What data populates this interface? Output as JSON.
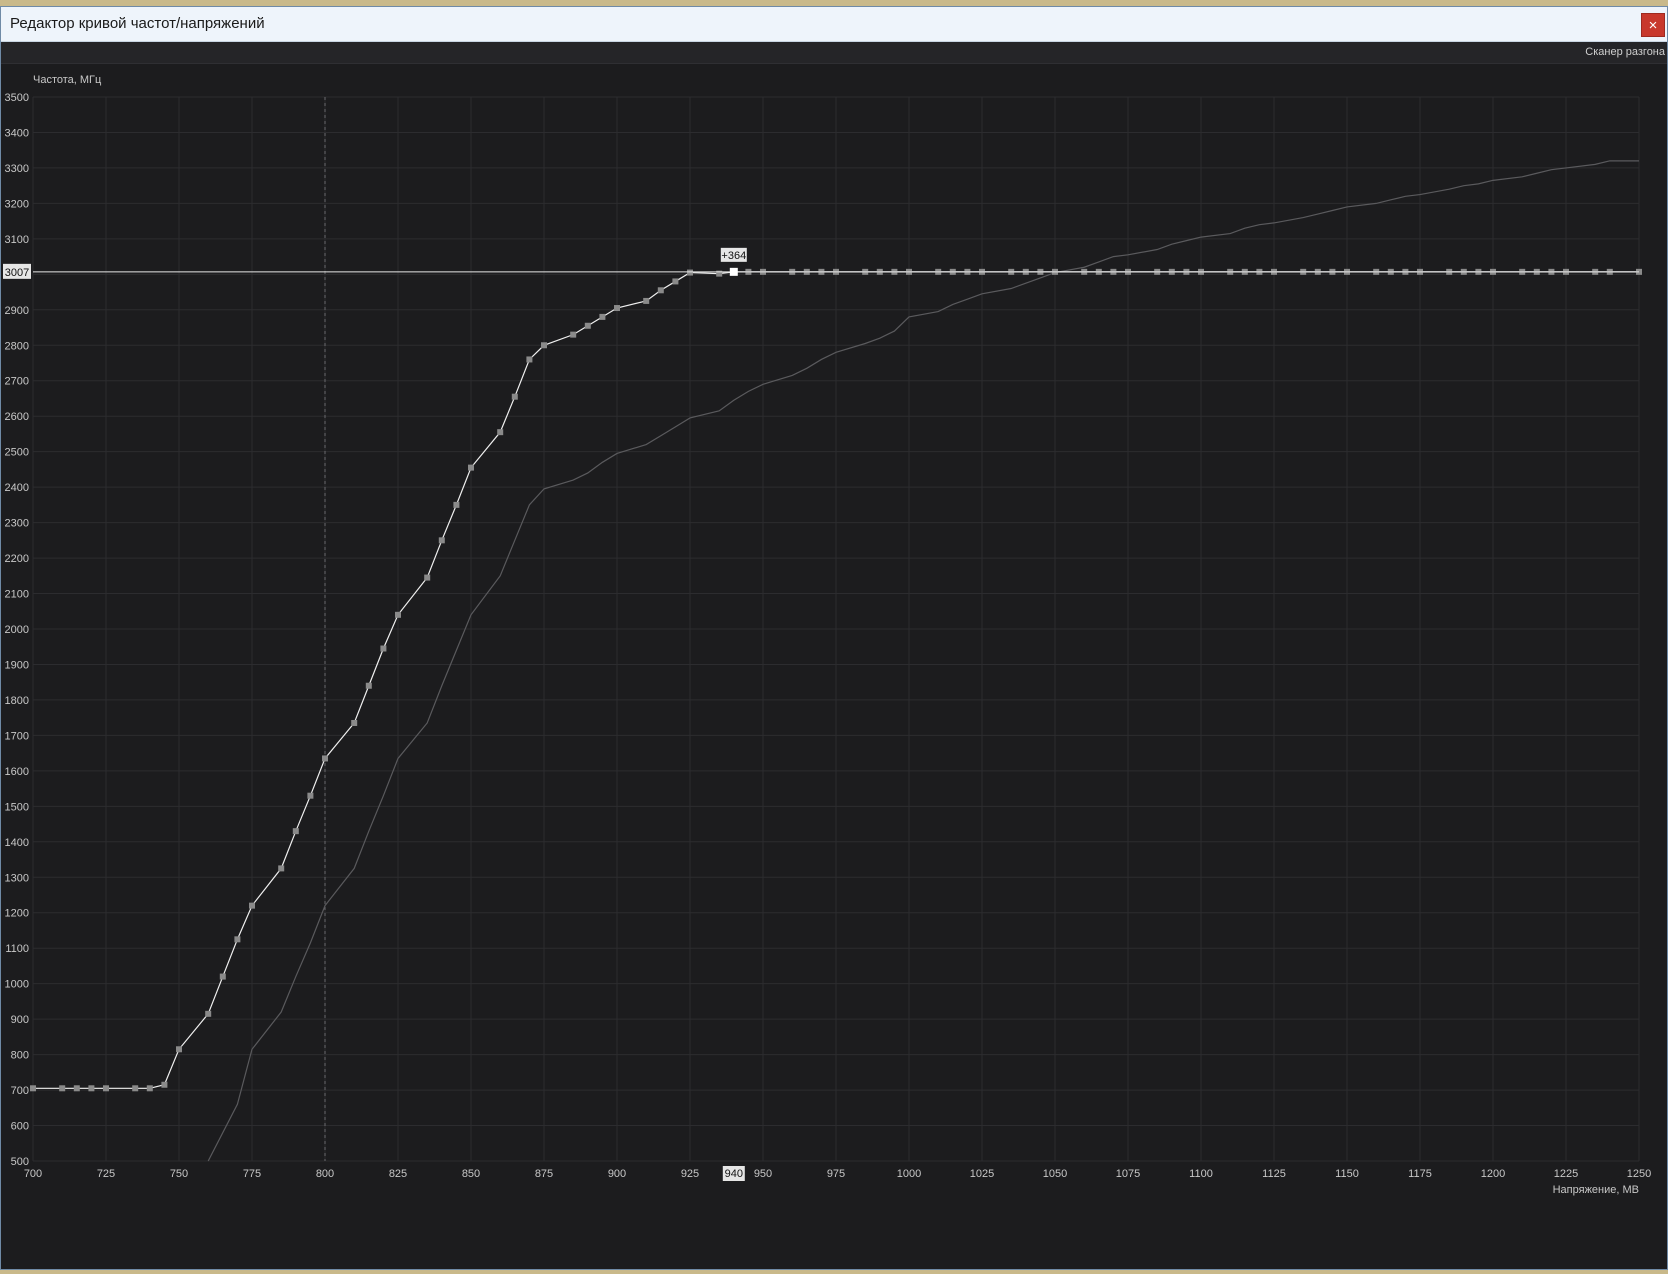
{
  "window": {
    "title": "Редактор кривой частот/напряжений",
    "close_glyph": "×"
  },
  "toolbar": {
    "scanner_label": "Сканер разгона"
  },
  "colors": {
    "background": "#1c1c1e",
    "grid": "#2c2c2f",
    "curve": "#f0f0f0",
    "reference_curve": "#5a5a5d",
    "point": "#8a8a8a",
    "axis_text": "#c8c8c8",
    "close": "#c8382c"
  },
  "chart_data": {
    "type": "line",
    "ylabel": "Частота, МГц",
    "xlabel": "Напряжение, МВ",
    "xlim": [
      700,
      1250
    ],
    "ylim": [
      500,
      3500
    ],
    "x_ticks": [
      700,
      725,
      750,
      775,
      800,
      825,
      850,
      875,
      900,
      925,
      950,
      975,
      1000,
      1025,
      1050,
      1075,
      1100,
      1125,
      1150,
      1175,
      1200,
      1225,
      1250
    ],
    "y_ticks": [
      500,
      600,
      700,
      800,
      900,
      1000,
      1100,
      1200,
      1300,
      1400,
      1500,
      1600,
      1700,
      1800,
      1900,
      2000,
      2100,
      2200,
      2300,
      2400,
      2500,
      2600,
      2700,
      2800,
      2900,
      3000,
      3100,
      3200,
      3300,
      3400,
      3500
    ],
    "grid": true,
    "vertical_marker_x": 800,
    "cursor": {
      "x": 940,
      "y": 3007,
      "x_label": "940",
      "y_label": "3007",
      "offset_label": "+364"
    },
    "series": [
      {
        "points": [
          [
            700,
            705
          ],
          [
            710,
            705
          ],
          [
            715,
            705
          ],
          [
            720,
            705
          ],
          [
            725,
            705
          ],
          [
            735,
            705
          ],
          [
            740,
            705
          ],
          [
            745,
            715
          ],
          [
            750,
            815
          ],
          [
            760,
            915
          ],
          [
            765,
            1020
          ],
          [
            770,
            1125
          ],
          [
            775,
            1220
          ],
          [
            785,
            1325
          ],
          [
            790,
            1430
          ],
          [
            795,
            1530
          ],
          [
            800,
            1635
          ],
          [
            810,
            1735
          ],
          [
            815,
            1840
          ],
          [
            820,
            1945
          ],
          [
            825,
            2040
          ],
          [
            835,
            2145
          ],
          [
            840,
            2250
          ],
          [
            845,
            2350
          ],
          [
            850,
            2455
          ],
          [
            860,
            2555
          ],
          [
            865,
            2655
          ],
          [
            870,
            2760
          ],
          [
            875,
            2800
          ],
          [
            885,
            2830
          ],
          [
            890,
            2855
          ],
          [
            895,
            2880
          ],
          [
            900,
            2905
          ],
          [
            910,
            2925
          ],
          [
            915,
            2955
          ],
          [
            920,
            2980
          ],
          [
            925,
            3005
          ],
          [
            935,
            3002
          ],
          [
            940,
            3007
          ],
          [
            945,
            3007
          ],
          [
            950,
            3007
          ],
          [
            960,
            3007
          ],
          [
            965,
            3007
          ],
          [
            970,
            3007
          ],
          [
            975,
            3007
          ],
          [
            985,
            3007
          ],
          [
            990,
            3007
          ],
          [
            995,
            3007
          ],
          [
            1000,
            3007
          ],
          [
            1010,
            3007
          ],
          [
            1015,
            3007
          ],
          [
            1020,
            3007
          ],
          [
            1025,
            3007
          ],
          [
            1035,
            3007
          ],
          [
            1040,
            3007
          ],
          [
            1045,
            3007
          ],
          [
            1050,
            3007
          ],
          [
            1060,
            3007
          ],
          [
            1065,
            3007
          ],
          [
            1070,
            3007
          ],
          [
            1075,
            3007
          ],
          [
            1085,
            3007
          ],
          [
            1090,
            3007
          ],
          [
            1095,
            3007
          ],
          [
            1100,
            3007
          ],
          [
            1110,
            3007
          ],
          [
            1115,
            3007
          ],
          [
            1120,
            3007
          ],
          [
            1125,
            3007
          ],
          [
            1135,
            3007
          ],
          [
            1140,
            3007
          ],
          [
            1145,
            3007
          ],
          [
            1150,
            3007
          ],
          [
            1160,
            3007
          ],
          [
            1165,
            3007
          ],
          [
            1170,
            3007
          ],
          [
            1175,
            3007
          ],
          [
            1185,
            3007
          ],
          [
            1190,
            3007
          ],
          [
            1195,
            3007
          ],
          [
            1200,
            3007
          ],
          [
            1210,
            3007
          ],
          [
            1215,
            3007
          ],
          [
            1220,
            3007
          ],
          [
            1225,
            3007
          ],
          [
            1235,
            3007
          ],
          [
            1240,
            3007
          ],
          [
            1250,
            3007
          ]
        ]
      },
      {
        "points": [
          [
            760,
            500
          ],
          [
            770,
            660
          ],
          [
            775,
            815
          ],
          [
            785,
            920
          ],
          [
            790,
            1020
          ],
          [
            795,
            1115
          ],
          [
            800,
            1220
          ],
          [
            810,
            1325
          ],
          [
            815,
            1430
          ],
          [
            820,
            1530
          ],
          [
            825,
            1635
          ],
          [
            835,
            1735
          ],
          [
            840,
            1840
          ],
          [
            845,
            1940
          ],
          [
            850,
            2040
          ],
          [
            860,
            2150
          ],
          [
            865,
            2250
          ],
          [
            870,
            2350
          ],
          [
            875,
            2395
          ],
          [
            885,
            2420
          ],
          [
            890,
            2440
          ],
          [
            895,
            2470
          ],
          [
            900,
            2495
          ],
          [
            910,
            2520
          ],
          [
            915,
            2545
          ],
          [
            920,
            2570
          ],
          [
            925,
            2595
          ],
          [
            935,
            2615
          ],
          [
            940,
            2645
          ],
          [
            945,
            2670
          ],
          [
            950,
            2690
          ],
          [
            960,
            2715
          ],
          [
            965,
            2735
          ],
          [
            970,
            2760
          ],
          [
            975,
            2780
          ],
          [
            985,
            2805
          ],
          [
            990,
            2820
          ],
          [
            995,
            2840
          ],
          [
            1000,
            2880
          ],
          [
            1010,
            2895
          ],
          [
            1015,
            2915
          ],
          [
            1020,
            2930
          ],
          [
            1025,
            2945
          ],
          [
            1035,
            2960
          ],
          [
            1040,
            2975
          ],
          [
            1045,
            2990
          ],
          [
            1050,
            3005
          ],
          [
            1060,
            3020
          ],
          [
            1065,
            3035
          ],
          [
            1070,
            3050
          ],
          [
            1075,
            3055
          ],
          [
            1085,
            3070
          ],
          [
            1090,
            3085
          ],
          [
            1095,
            3095
          ],
          [
            1100,
            3105
          ],
          [
            1110,
            3115
          ],
          [
            1115,
            3130
          ],
          [
            1120,
            3140
          ],
          [
            1125,
            3145
          ],
          [
            1135,
            3160
          ],
          [
            1140,
            3170
          ],
          [
            1145,
            3180
          ],
          [
            1150,
            3190
          ],
          [
            1160,
            3200
          ],
          [
            1165,
            3210
          ],
          [
            1170,
            3220
          ],
          [
            1175,
            3225
          ],
          [
            1185,
            3240
          ],
          [
            1190,
            3250
          ],
          [
            1195,
            3255
          ],
          [
            1200,
            3265
          ],
          [
            1210,
            3275
          ],
          [
            1215,
            3285
          ],
          [
            1220,
            3295
          ],
          [
            1225,
            3300
          ],
          [
            1235,
            3310
          ],
          [
            1240,
            3320
          ],
          [
            1250,
            3320
          ]
        ]
      }
    ]
  }
}
